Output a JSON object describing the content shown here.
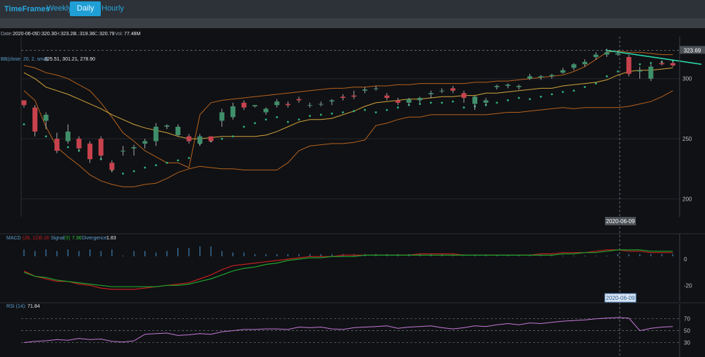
{
  "toolbar": {
    "brand": "TimeFrames",
    "tabs": [
      {
        "label": "Weekly",
        "active": false
      },
      {
        "label": "Daily",
        "active": true
      },
      {
        "label": "Hourly",
        "active": false
      }
    ]
  },
  "info": {
    "date_label": "Date:",
    "date": "2020-06-09",
    "o_label": "O:",
    "open": "320.30",
    "h_label": "H:",
    "high": "323.28",
    "l_label": "L:",
    "low": "319.36",
    "c_label": "C:",
    "close": "320.79",
    "v_label": "Vol:",
    "volume": "77.48M",
    "bb_label": "BB(close, 20, 2, sma)",
    "bb_values": "325.51, 301.21, 278.90",
    "macd_label": "MACD",
    "macd_params": "(26, 12)",
    "macd_value": "6.16",
    "signal_label": "Signal",
    "signal_params": "(9)",
    "signal_value": "7.36",
    "div_label": "Divergence:",
    "div_value": "1.83",
    "rsi_label": "RSI (14):",
    "rsi_value": "71.84"
  },
  "markers": {
    "price_marker": "323.69",
    "date_marker_main": "2020-06-09",
    "date_marker_macd": "2020-06-09"
  },
  "colors": {
    "up": "#3f8f6a",
    "down": "#c8424d",
    "bb_outer": "#b5621f",
    "bb_mid": "#d3a53c",
    "sar": "#2eb67d",
    "macd": "#c21f1f",
    "signal": "#1fa32d",
    "rsi": "#c47ad8",
    "hist": "#3d7fb0",
    "trend": "#2ad4a6"
  },
  "chart_data": [
    {
      "type": "candlestick",
      "title": "Daily",
      "ylim": [
        185,
        335
      ],
      "y_ticks": [
        200,
        250,
        300
      ],
      "grid": true,
      "ohlc": [
        [
          null,
          282,
          276,
          278
        ],
        [
          276,
          278,
          252,
          256
        ],
        [
          265,
          272,
          258,
          270
        ],
        [
          250,
          255,
          238,
          240
        ],
        [
          248,
          262,
          246,
          256
        ],
        [
          250,
          252,
          240,
          242
        ],
        [
          246,
          248,
          230,
          233
        ],
        [
          250,
          252,
          233,
          236
        ],
        [
          230,
          232,
          222,
          224
        ],
        [
          240,
          244,
          236,
          240
        ],
        [
          242,
          245,
          236,
          243
        ],
        [
          246,
          250,
          242,
          248
        ],
        [
          248,
          263,
          244,
          260
        ],
        [
          260,
          262,
          258,
          261
        ],
        [
          253,
          262,
          252,
          260
        ],
        [
          252,
          254,
          246,
          248
        ],
        [
          246,
          254,
          244,
          252
        ],
        [
          252,
          252,
          247,
          248
        ],
        [
          265,
          275,
          260,
          272
        ],
        [
          268,
          280,
          266,
          277
        ],
        [
          280,
          282,
          274,
          276
        ],
        [
          277,
          278,
          276,
          278
        ],
        [
          272,
          276,
          270,
          275
        ],
        [
          278,
          283,
          276,
          281
        ],
        [
          279,
          281,
          276,
          278
        ],
        [
          283,
          285,
          280,
          282
        ],
        [
          278,
          280,
          276,
          278
        ],
        [
          279,
          281,
          277,
          279
        ],
        [
          281,
          283,
          278,
          282
        ],
        [
          285,
          287,
          282,
          284
        ],
        [
          286,
          290,
          283,
          285
        ],
        [
          290,
          293,
          288,
          291
        ],
        [
          292,
          294,
          290,
          292
        ],
        [
          286,
          288,
          282,
          284
        ],
        [
          282,
          284,
          278,
          280
        ],
        [
          280,
          284,
          278,
          283
        ],
        [
          282,
          285,
          280,
          284
        ],
        [
          287,
          290,
          284,
          288
        ],
        [
          290,
          292,
          288,
          290
        ],
        [
          292,
          294,
          288,
          290
        ],
        [
          288,
          290,
          280,
          284
        ],
        [
          279,
          286,
          274,
          285
        ],
        [
          280,
          284,
          278,
          282
        ],
        [
          293,
          295,
          291,
          294
        ],
        [
          294,
          296,
          292,
          295
        ],
        [
          293,
          295,
          291,
          294
        ],
        [
          300,
          304,
          299,
          302
        ],
        [
          301,
          303,
          299,
          302
        ],
        [
          302,
          304,
          300,
          303
        ],
        [
          305,
          309,
          304,
          307
        ],
        [
          309,
          313,
          307,
          312
        ],
        [
          312,
          316,
          310,
          314
        ],
        [
          318,
          322,
          316,
          320
        ],
        [
          320,
          325,
          318,
          322
        ],
        [
          320,
          323,
          319,
          321
        ],
        [
          318,
          320,
          302,
          304
        ],
        [
          306,
          310,
          300,
          307
        ],
        [
          300,
          312,
          298,
          310
        ],
        [
          313,
          315,
          311,
          312
        ],
        [
          313,
          315,
          310,
          311
        ]
      ],
      "bollinger": {
        "upper": [
          311,
          309,
          305,
          303,
          300,
          295,
          290,
          280,
          268,
          255,
          248,
          240,
          235,
          230,
          230,
          226,
          270,
          280,
          282,
          283,
          284,
          285,
          286,
          287,
          288,
          289,
          290,
          291,
          292,
          292,
          293,
          293,
          294,
          294,
          295,
          295,
          296,
          296,
          296,
          296,
          296,
          297,
          297,
          298,
          298,
          299,
          300,
          301,
          302,
          303,
          306,
          310,
          316,
          322,
          323,
          322,
          322,
          321,
          320,
          320
        ],
        "middle": [
          305,
          300,
          293,
          290,
          287,
          283,
          279,
          275,
          270,
          266,
          262,
          259,
          257,
          255,
          252,
          250,
          250,
          251,
          252,
          252,
          252,
          252,
          253,
          256,
          260,
          264,
          266,
          266,
          267,
          270,
          273,
          277,
          280,
          281,
          282,
          283,
          283,
          284,
          285,
          285,
          286,
          286,
          288,
          288,
          289,
          290,
          291,
          292,
          292,
          294,
          295,
          296,
          297,
          299,
          303,
          306,
          307,
          307,
          308,
          309
        ],
        "lower": [
          290,
          282,
          260,
          243,
          235,
          228,
          220,
          215,
          212,
          210,
          210,
          212,
          213,
          217,
          222,
          225,
          227,
          226,
          225,
          225,
          224,
          224,
          224,
          224,
          230,
          240,
          244,
          245,
          246,
          246,
          247,
          249,
          261,
          263,
          266,
          268,
          268,
          270,
          270,
          270,
          270,
          270,
          270,
          271,
          272,
          272,
          273,
          274,
          275,
          276,
          275,
          276,
          276,
          276,
          276,
          277,
          279,
          281,
          285,
          290
        ]
      },
      "parabolic_sar": [
        262,
        258,
        252,
        247,
        243,
        240,
        236,
        233,
        224,
        221,
        223,
        226,
        228,
        230,
        232,
        234,
        246,
        248,
        250,
        252,
        260,
        263,
        266,
        268,
        264,
        266,
        269,
        270,
        271,
        272,
        273,
        274,
        272,
        274,
        276,
        278,
        279,
        280,
        280,
        281,
        276,
        277,
        278,
        280,
        282,
        284,
        283,
        285,
        287,
        289,
        290,
        293,
        296,
        302,
        306,
        311,
        312,
        313,
        314,
        315
      ],
      "trendline": [
        [
          53,
          323.69
        ],
        [
          59,
          316
        ]
      ]
    },
    {
      "type": "macd",
      "title": "MACD (26, 12)",
      "ylim": [
        -30,
        15
      ],
      "y_ticks": [
        0,
        -20
      ],
      "macd": [
        -9,
        -13,
        -15,
        -17,
        -17,
        -19,
        -20,
        -22,
        -23,
        -23,
        -23,
        -22,
        -21,
        -20,
        -19,
        -18,
        -15,
        -12,
        -8,
        -5,
        -4,
        -3,
        -2,
        -1,
        0,
        1,
        2,
        2,
        2,
        3,
        3,
        3,
        3,
        3,
        3,
        3,
        4,
        4,
        4,
        4,
        3,
        3,
        3,
        3,
        3,
        3,
        3,
        4,
        4,
        5,
        5,
        5,
        6,
        7,
        7,
        6,
        6,
        5,
        5,
        5
      ],
      "signal": [
        -10,
        -13,
        -14,
        -16,
        -17,
        -18,
        -19,
        -20,
        -21,
        -21,
        -21,
        -21,
        -21,
        -20,
        -20,
        -19,
        -17,
        -15,
        -12,
        -9,
        -7,
        -6,
        -4,
        -3,
        -1,
        0,
        1,
        1,
        2,
        2,
        2,
        3,
        3,
        3,
        3,
        3,
        3,
        3,
        3,
        3,
        3,
        3,
        3,
        3,
        3,
        3,
        3,
        3,
        3,
        4,
        4,
        5,
        5,
        6,
        7,
        7,
        7,
        6,
        6,
        6
      ],
      "divergence": [
        -4,
        -3,
        -4,
        -3,
        -4,
        -3,
        -4,
        -3,
        -4,
        0,
        3,
        3,
        2,
        3,
        5,
        5,
        6,
        6,
        3,
        2,
        2,
        1,
        1,
        1,
        1,
        1,
        1,
        1,
        1,
        1,
        1,
        1,
        1,
        1,
        1,
        1,
        1,
        1,
        1,
        0,
        0,
        0,
        0,
        0,
        0,
        0,
        0,
        0,
        0,
        0,
        0,
        0,
        0,
        0,
        -1,
        -1,
        -1,
        -1,
        -1,
        -1
      ]
    },
    {
      "type": "line",
      "title": "RSI (14)",
      "ylim": [
        20,
        85
      ],
      "y_ticks": [
        70,
        50,
        30
      ],
      "values": [
        30,
        32,
        33,
        35,
        34,
        37,
        35,
        36,
        32,
        31,
        33,
        44,
        45,
        46,
        42,
        43,
        45,
        44,
        48,
        50,
        52,
        52,
        53,
        53,
        52,
        56,
        55,
        56,
        53,
        52,
        55,
        56,
        57,
        58,
        54,
        56,
        57,
        58,
        55,
        53,
        55,
        58,
        57,
        60,
        62,
        60,
        63,
        62,
        64,
        66,
        67,
        68,
        70,
        71,
        72,
        71,
        50,
        54,
        56,
        57
      ]
    }
  ]
}
